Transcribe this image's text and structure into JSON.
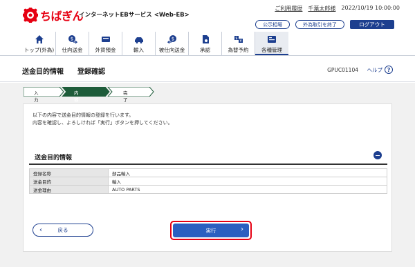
{
  "header": {
    "logo_text": "ちばぎん",
    "service_name": "インターネットEBサービス <Web-EB>",
    "links": {
      "usage_history": "ご利用履歴",
      "user_name": "千葉太郎様",
      "datetime": "2022/10/19 10:00:00"
    },
    "buttons": {
      "rates": "公示相場",
      "end_fx": "外為取引を終了",
      "logout": "ログアウト"
    }
  },
  "nav": {
    "items": [
      {
        "label": "トップ(外為)",
        "icon": "home-icon"
      },
      {
        "label": "仕向送金",
        "icon": "remittance-icon"
      },
      {
        "label": "外貨預金",
        "icon": "deposit-icon"
      },
      {
        "label": "輸入",
        "icon": "import-icon"
      },
      {
        "label": "被仕向送金",
        "icon": "incoming-remittance-icon"
      },
      {
        "label": "承認",
        "icon": "approval-icon"
      },
      {
        "label": "為替予約",
        "icon": "fx-contract-icon"
      },
      {
        "label": "各種管理",
        "icon": "management-icon"
      }
    ],
    "active_index": 7
  },
  "page": {
    "title": "送金目的情報",
    "subtitle": "登録確認",
    "screen_id": "GPUC01104",
    "help_label": "ヘルプ",
    "help_icon": "?"
  },
  "steps": [
    "入力",
    "内容確認",
    "完了"
  ],
  "intro": {
    "line1": "以下の内容で送金目的情報の登録を行います。",
    "line2": "内容を確認し、よろしければ「実行」ボタンを押してください。"
  },
  "section": {
    "title": "送金目的情報"
  },
  "details": [
    {
      "key": "登録名称",
      "value": "部品輸入"
    },
    {
      "key": "送金目的",
      "value": "輸入"
    },
    {
      "key": "送金理由",
      "value": "AUTO PARTS"
    }
  ],
  "actions": {
    "back": "戻る",
    "execute": "実行",
    "back_chevron": "‹",
    "execute_chevron": "›"
  },
  "colors": {
    "brand_red": "#e60012",
    "navy": "#1d3f8f",
    "execute_blue": "#2b5fc0",
    "step_active": "#1e5c3a"
  }
}
